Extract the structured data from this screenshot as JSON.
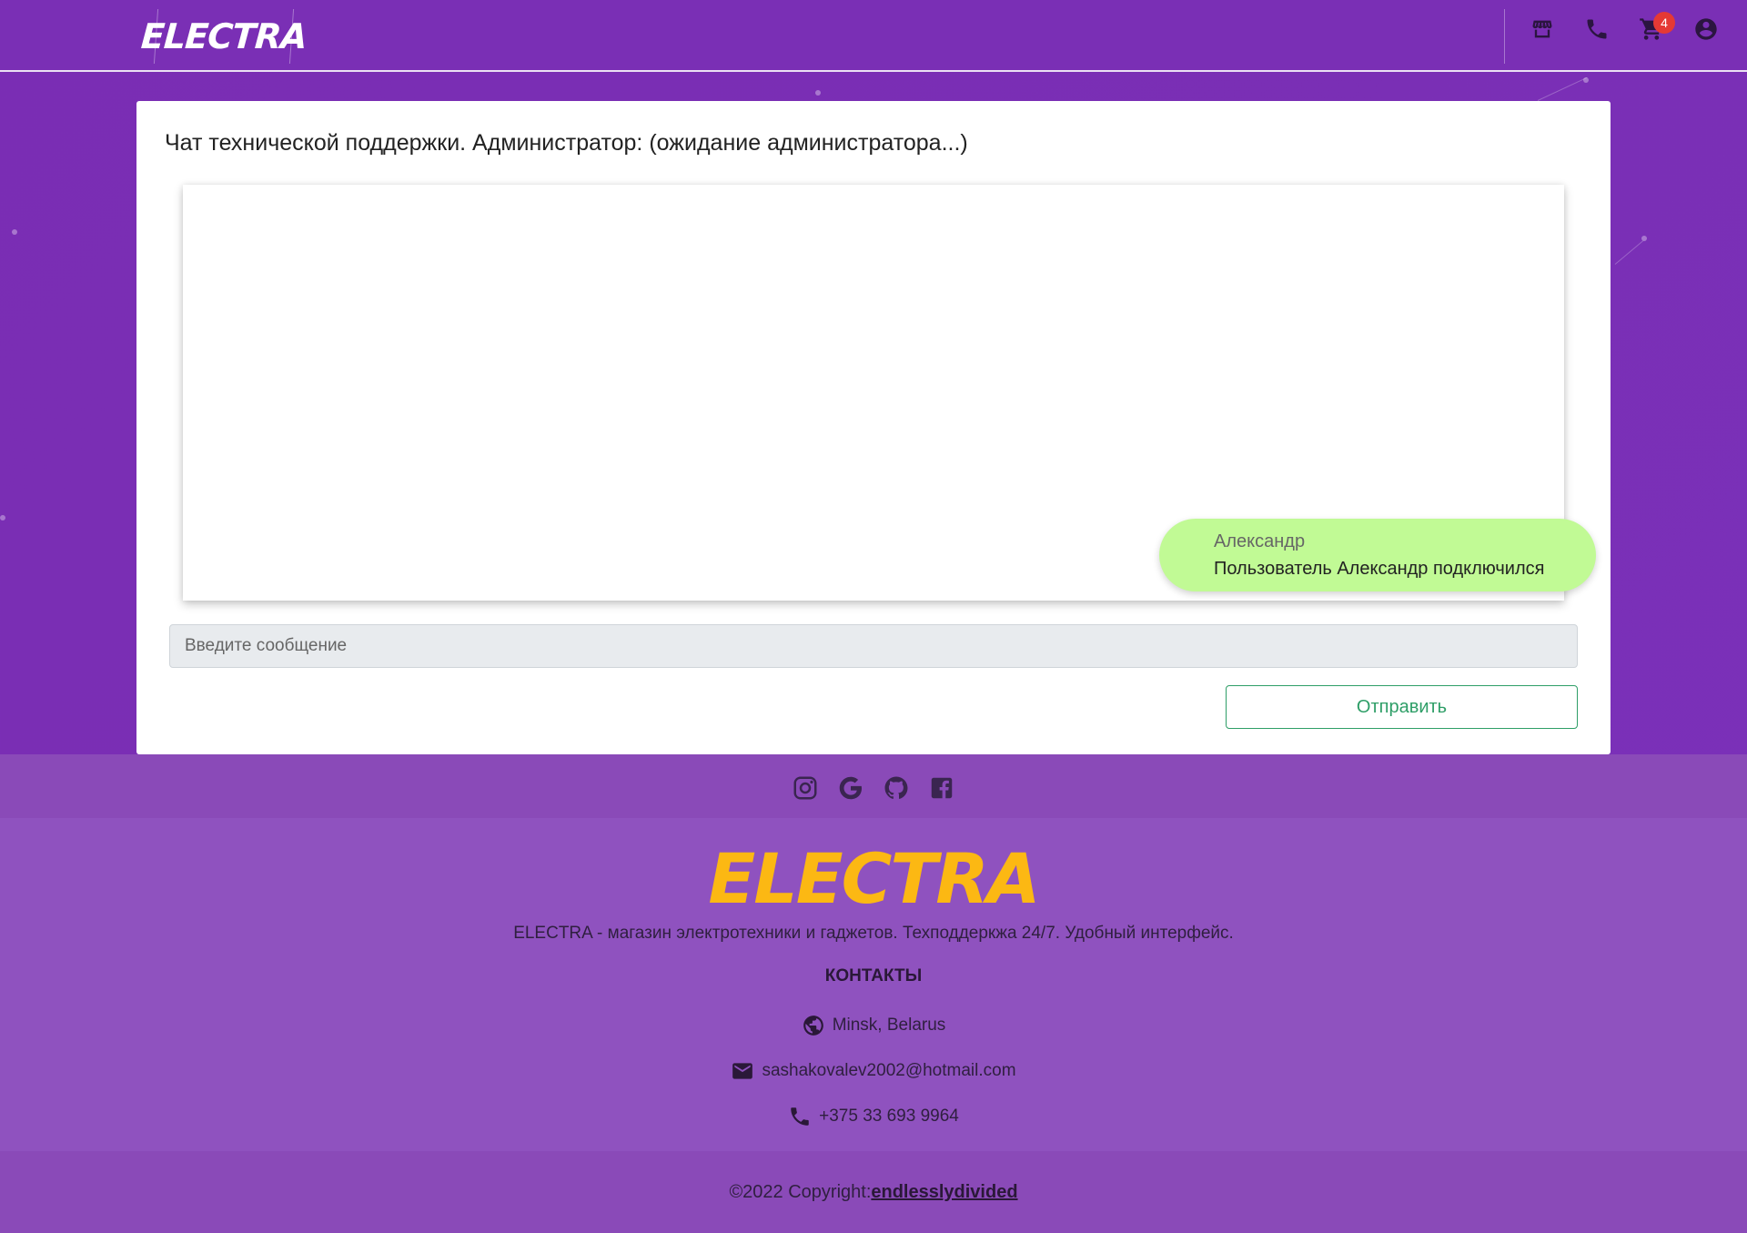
{
  "navbar": {
    "brand": "ELECTRA",
    "icons": [
      "store-icon",
      "phone-icon",
      "cart-icon",
      "account-icon"
    ],
    "cart_count": "4"
  },
  "chat": {
    "title": "Чат технической поддержки. Администратор: (ожидание администратора...)",
    "messages": [
      {
        "author": "Александр",
        "text": "Пользователь Александр подключился",
        "bubble_color": "#c1fa95"
      }
    ],
    "input_placeholder": "Введите сообщение",
    "send_label": "Отправить"
  },
  "footer": {
    "social_icons": [
      "instagram-icon",
      "google-icon",
      "github-icon",
      "facebook-icon"
    ],
    "logo": "ELECTRA",
    "logo_color": "#fcb813",
    "description": "ELECTRA - магазин электротехники и гаджетов. Техподдеркжа 24/7. Удобный интерфейс.",
    "contacts_heading": "КОНТАКТЫ",
    "contacts": {
      "location": "Minsk, Belarus",
      "email": "sashakovalev2002@hotmail.com",
      "phone": "+375 33 693 9964"
    },
    "copyright_prefix": "©2022 Copyright:",
    "copyright_link": "endlesslydivided"
  },
  "colors": {
    "background": "#7a2fb5",
    "send_button": "#2e9e67",
    "badge": "#e53935"
  }
}
